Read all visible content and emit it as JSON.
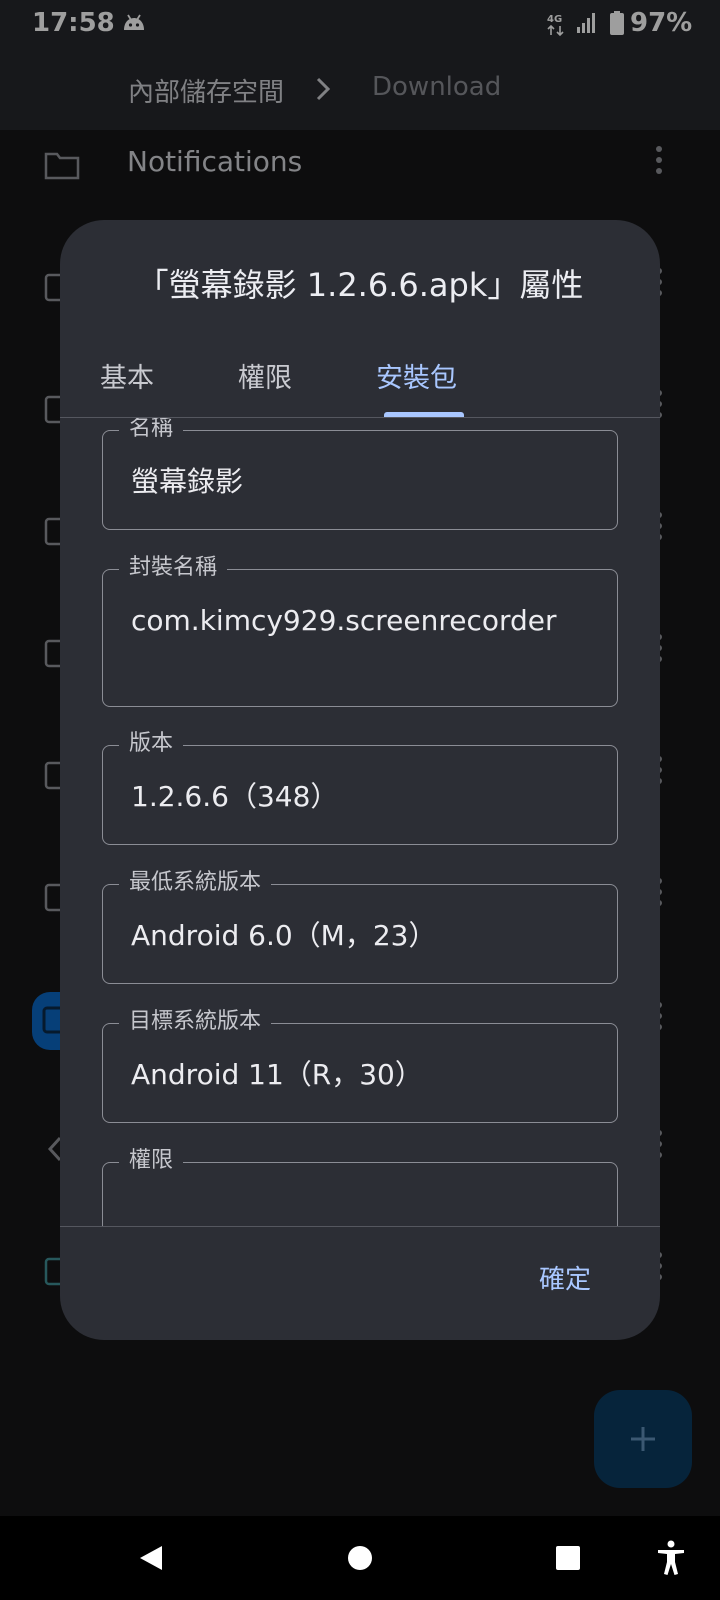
{
  "status_bar": {
    "time": "17:58",
    "battery": "97%",
    "icons": [
      "android-notification-icon",
      "network-4g-icon",
      "signal-icon",
      "battery-icon"
    ]
  },
  "breadcrumb": {
    "root": "內部儲存空間",
    "current": "Download"
  },
  "file_list": {
    "first_item": "Notifications",
    "folder_color": "#8f9096",
    "highlight_color": "#0a66c2"
  },
  "dialog": {
    "title": "「螢幕錄影 1.2.6.6.apk」屬性",
    "tabs": [
      {
        "label": "基本"
      },
      {
        "label": "權限"
      },
      {
        "label": "安裝包",
        "active": true
      }
    ],
    "fields": [
      {
        "label": "名稱",
        "value": "螢幕錄影"
      },
      {
        "label": "封裝名稱",
        "value": "com.kimcy929.screenrecorder"
      },
      {
        "label": "版本",
        "value": "1.2.6.6（348）"
      },
      {
        "label": "最低系統版本",
        "value": "Android 6.0（M，23）"
      },
      {
        "label": "目標系統版本",
        "value": "Android 11（R，30）"
      },
      {
        "label": "權限",
        "value": ""
      }
    ],
    "ok_label": "確定",
    "accent_color": "#a9c7ff"
  },
  "fab": {
    "icon": "plus-icon"
  },
  "nav_bar": {
    "icons": [
      "back-icon",
      "home-icon",
      "recents-icon",
      "accessibility-icon"
    ]
  }
}
